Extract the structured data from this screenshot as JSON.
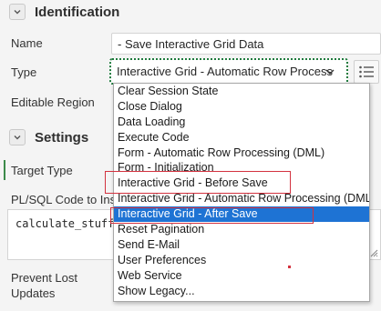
{
  "identification": {
    "title": "Identification",
    "name_label": "Name",
    "name_value": "- Save Interactive Grid Data",
    "type_label": "Type",
    "type_value": "Interactive Grid - Automatic Row Process",
    "editable_region_label": "Editable Region"
  },
  "settings": {
    "title": "Settings",
    "target_type_label": "Target Type",
    "plsql_label": "PL/SQL Code to Inse",
    "code_value": "calculate_stuff(:r",
    "prevent_lost_updates_label_line1": "Prevent Lost",
    "prevent_lost_updates_label_line2": "Updates"
  },
  "dropdown": {
    "items": [
      "Clear Session State",
      "Close Dialog",
      "Data Loading",
      "Execute Code",
      "Form - Automatic Row Processing (DML)",
      "Form - Initialization",
      "Interactive Grid - Before Save",
      "Interactive Grid - Automatic Row Processing (DML)",
      "Interactive Grid - After Save",
      "Reset Pagination",
      "Send E-Mail",
      "User Preferences",
      "Web Service",
      "Show Legacy..."
    ],
    "selected_item": "Interactive Grid - After Save"
  },
  "colors": {
    "selection": "#1e73d4",
    "highlight_box": "#d3323f",
    "focus_border": "#1f7a3d",
    "target_marker": "#3c8a4a"
  },
  "icons": {
    "section_toggle": "chevron-down-icon",
    "type_select": "chevron-down-icon",
    "list_button": "list-icon"
  }
}
